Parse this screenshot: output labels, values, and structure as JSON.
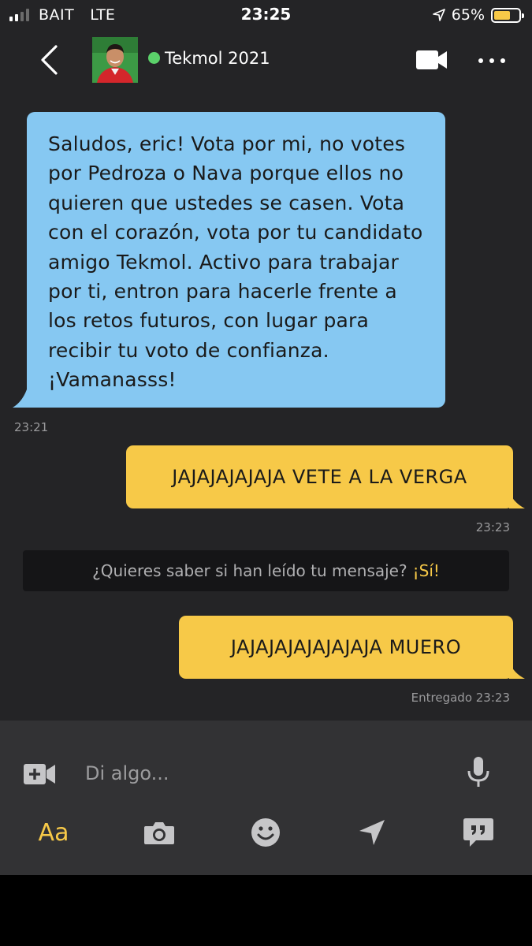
{
  "status_bar": {
    "carrier": "BAIT",
    "network": "LTE",
    "time": "23:25",
    "battery": "65%",
    "battery_level": 0.65,
    "battery_color": "#f7c948"
  },
  "header": {
    "contact_name": "Tekmol 2021",
    "online_color": "#5bd16a"
  },
  "messages": [
    {
      "direction": "incoming",
      "lines": [
        "Saludos, eric! Vota por mi, no votes",
        "por Pedroza o Nava porque ellos no",
        "quieren que ustedes se casen. Vota",
        "con el corazón, vota por tu candidato",
        "amigo Tekmol. Activo para trabajar",
        "por ti, entron para hacerle frente a",
        "los retos futuros, con lugar para",
        "recibir tu voto de confianza.",
        "¡Vamanasss!"
      ],
      "time": "23:21"
    },
    {
      "direction": "outgoing",
      "text": "JAJAJAJAJAJA VETE A LA VERGA",
      "time": "23:23"
    },
    {
      "direction": "outgoing",
      "text": "JAJAJAJAJAJAJAJA MUERO",
      "time": "Entregado 23:23"
    }
  ],
  "read_receipt_banner": {
    "question": "¿Quieres saber si han leído tu mensaje?",
    "cta": "¡Sí!"
  },
  "composer": {
    "placeholder": "Di algo...",
    "toolbar": {
      "text_format_label": "Aa",
      "icons": [
        "camera-icon",
        "emoji-icon",
        "location-icon",
        "saved-phrases-icon"
      ]
    }
  },
  "colors": {
    "incoming_bubble": "#86c8f2",
    "outgoing_bubble": "#f7c948",
    "background": "#242426",
    "accent": "#f7c948"
  }
}
